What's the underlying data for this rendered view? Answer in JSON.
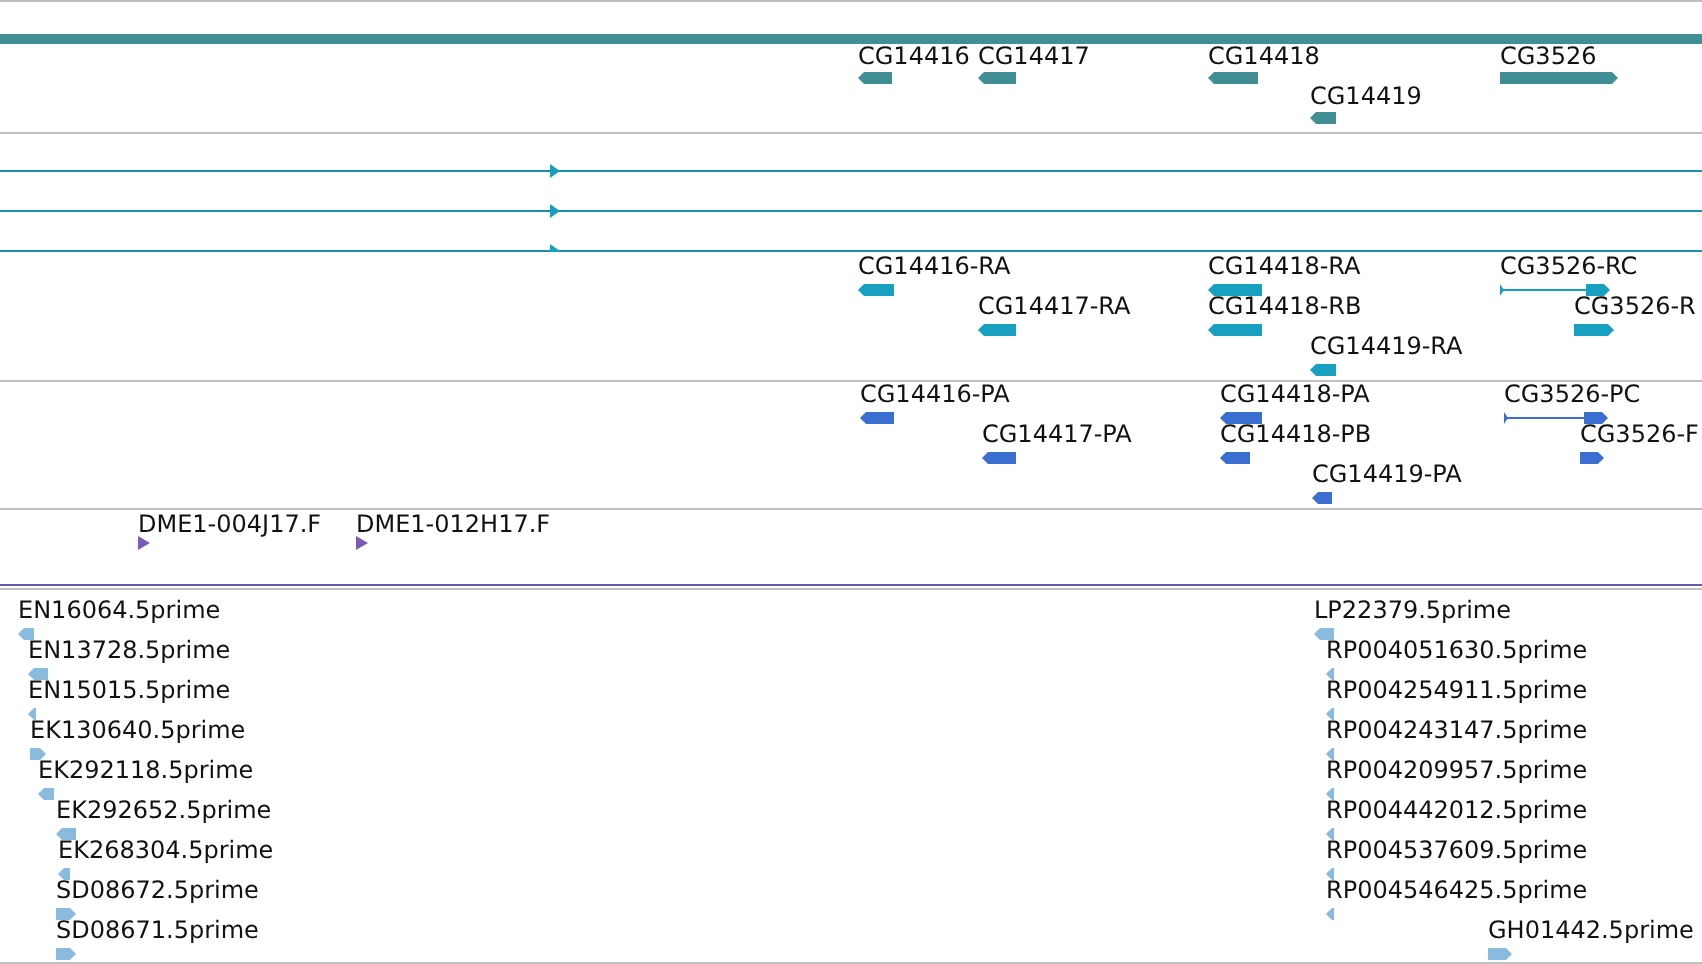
{
  "tracks": [
    {
      "kind": "gene",
      "features": [
        {
          "label": "CG14416",
          "reverse": true
        },
        {
          "label": "CG14417",
          "reverse": true
        },
        {
          "label": "CG14418",
          "reverse": true
        },
        {
          "label": "CG14419",
          "reverse": true
        },
        {
          "label": "CG3526",
          "reverse": false
        }
      ]
    },
    {
      "kind": "span",
      "features": [
        {
          "reverse": false
        },
        {
          "reverse": false
        },
        {
          "reverse": false
        }
      ]
    },
    {
      "kind": "transcript",
      "features": [
        {
          "label": "CG14416-RA",
          "reverse": true,
          "spliced": false
        },
        {
          "label": "CG14417-RA",
          "reverse": true,
          "spliced": false
        },
        {
          "label": "CG14418-RA",
          "reverse": true,
          "spliced": false
        },
        {
          "label": "CG14418-RB",
          "reverse": true,
          "spliced": false
        },
        {
          "label": "CG14419-RA",
          "reverse": true,
          "spliced": false
        },
        {
          "label": "CG3526-RC",
          "reverse": false,
          "spliced": true
        },
        {
          "label": "CG3526-R",
          "reverse": false,
          "spliced": false
        }
      ]
    },
    {
      "kind": "protein",
      "features": [
        {
          "label": "CG14416-PA",
          "reverse": true,
          "spliced": false
        },
        {
          "label": "CG14417-PA",
          "reverse": true,
          "spliced": false
        },
        {
          "label": "CG14418-PA",
          "reverse": true,
          "spliced": false
        },
        {
          "label": "CG14418-PB",
          "reverse": true,
          "spliced": false
        },
        {
          "label": "CG14419-PA",
          "reverse": true,
          "spliced": false
        },
        {
          "label": "CG3526-PC",
          "reverse": false,
          "spliced": true
        },
        {
          "label": "CG3526-F",
          "reverse": false,
          "spliced": false
        }
      ]
    },
    {
      "kind": "clone",
      "features": [
        {
          "label": "DME1-004J17.F",
          "reverse": false
        },
        {
          "label": "DME1-012H17.F",
          "reverse": false
        }
      ]
    },
    {
      "kind": "est",
      "features": [
        {
          "label": "EN16064.5prime",
          "reverse": true
        },
        {
          "label": "LP22379.5prime",
          "reverse": true
        },
        {
          "label": "EN13728.5prime",
          "reverse": true
        },
        {
          "label": "RP004051630.5prime",
          "reverse": true
        },
        {
          "label": "EN15015.5prime",
          "reverse": true
        },
        {
          "label": "RP004254911.5prime",
          "reverse": true
        },
        {
          "label": "EK130640.5prime",
          "reverse": false
        },
        {
          "label": "RP004243147.5prime",
          "reverse": true
        },
        {
          "label": "EK292118.5prime",
          "reverse": true
        },
        {
          "label": "RP004209957.5prime",
          "reverse": true
        },
        {
          "label": "EK292652.5prime",
          "reverse": true
        },
        {
          "label": "RP004442012.5prime",
          "reverse": true
        },
        {
          "label": "EK268304.5prime",
          "reverse": true
        },
        {
          "label": "RP004537609.5prime",
          "reverse": true
        },
        {
          "label": "SD08672.5prime",
          "reverse": false
        },
        {
          "label": "RP004546425.5prime",
          "reverse": true
        },
        {
          "label": "SD08671.5prime",
          "reverse": false
        },
        {
          "label": "GH01442.5prime",
          "reverse": false
        }
      ]
    }
  ]
}
